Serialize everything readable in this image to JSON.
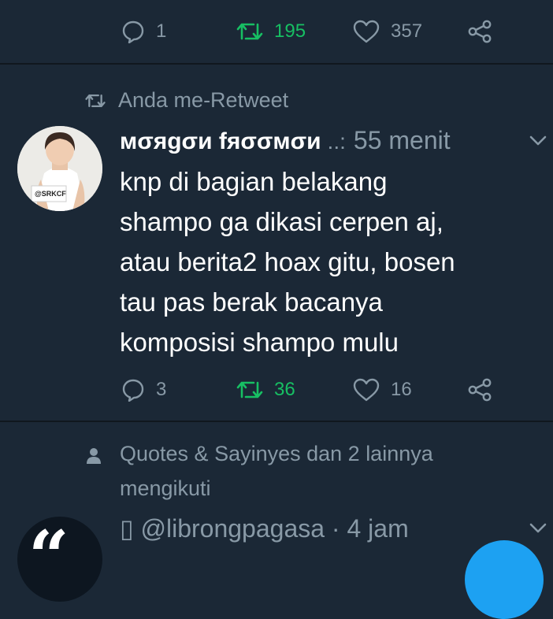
{
  "top_tweet": {
    "actions": {
      "replies": "1",
      "retweets": "195",
      "likes": "357"
    }
  },
  "retweet_context": "Anda me-Retweet",
  "main_tweet": {
    "display_name": "мσяgσи fяσσмσи",
    "name_suffix": "..:",
    "time": "55 menit",
    "text_lines": [
      "knp di bagian belakang",
      "shampo ga dikasi cerpen aj,",
      "atau berita2 hoax gitu, bosen",
      "tau pas berak bacanya",
      "komposisi shampo mulu"
    ],
    "avatar_sign_text": "@SRKCF",
    "actions": {
      "replies": "3",
      "retweets": "36",
      "likes": "16"
    }
  },
  "follow_context": {
    "line1": "Quotes & Sayinyes dan 2 lainnya",
    "line2": "mengikuti"
  },
  "next_tweet": {
    "header": "▯ @librongpagasa · 4 jam",
    "avatar_glyph": "“"
  },
  "colors": {
    "background": "#1b2836",
    "divider": "#10171e",
    "muted": "#8899a6",
    "retweet_green": "#17bf63",
    "accent_blue": "#1da1f2"
  }
}
